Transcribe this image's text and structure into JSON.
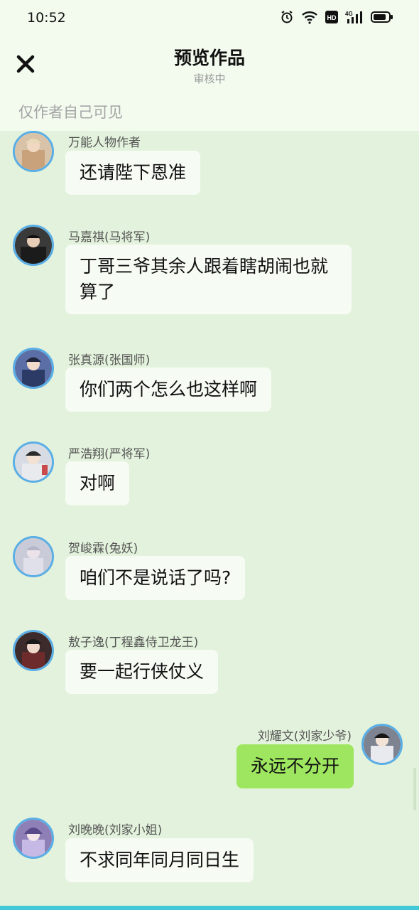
{
  "status_bar": {
    "time": "10:52"
  },
  "header": {
    "title": "预览作品",
    "subtitle": "审核中",
    "visibility": "仅作者自己可见"
  },
  "messages": [
    {
      "name": "万能人物作者",
      "text": "还请陛下恩准",
      "side": "left"
    },
    {
      "name": "马嘉祺(马将军)",
      "text": "丁哥三爷其余人跟着瞎胡闹也就算了",
      "side": "left"
    },
    {
      "name": "张真源(张国师)",
      "text": "你们两个怎么也这样啊",
      "side": "left"
    },
    {
      "name": "严浩翔(严将军)",
      "text": "对啊",
      "side": "left"
    },
    {
      "name": "贺峻霖(兔妖)",
      "text": "咱们不是说话了吗?",
      "side": "left"
    },
    {
      "name": "敖子逸(丁程鑫侍卫龙王)",
      "text": "要一起行侠仗义",
      "side": "left"
    },
    {
      "name": "刘耀文(刘家少爷)",
      "text": "永远不分开",
      "side": "right"
    },
    {
      "name": "刘晚晚(刘家小姐)",
      "text": "不求同年同月同日生",
      "side": "left"
    }
  ],
  "colors": {
    "accent_border": "#5aaee6",
    "bubble_right": "#9ee65f",
    "background": "#e3f2dc"
  }
}
